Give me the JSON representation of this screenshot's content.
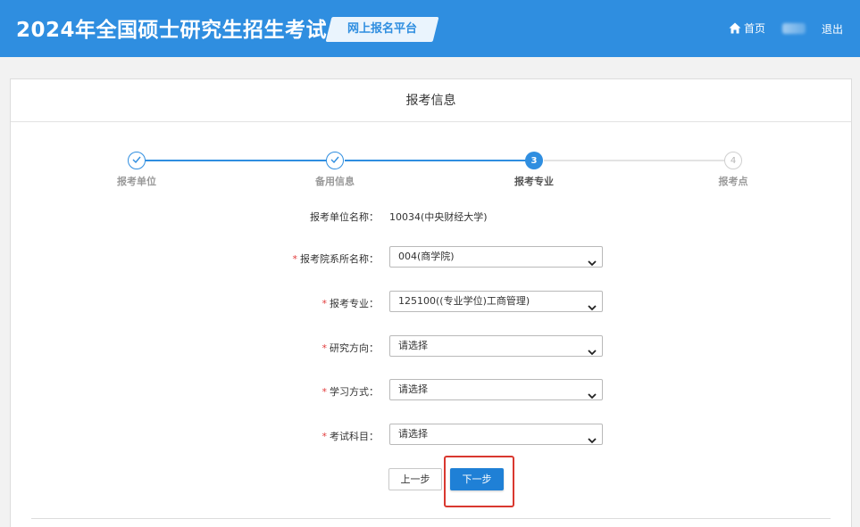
{
  "header": {
    "title": "2024年全国硕士研究生招生考试",
    "badge": "网上报名平台",
    "home_label": "首页",
    "logout_label": "退出"
  },
  "card": {
    "title": "报考信息"
  },
  "steps": [
    {
      "number": "1",
      "label": "报考单位",
      "state": "done"
    },
    {
      "number": "2",
      "label": "备用信息",
      "state": "done"
    },
    {
      "number": "3",
      "label": "报考专业",
      "state": "active"
    },
    {
      "number": "4",
      "label": "报考点",
      "state": "todo"
    }
  ],
  "form": {
    "unit": {
      "label": "报考单位名称：",
      "value": "10034(中央财经大学)"
    },
    "department": {
      "label": "报考院系所名称：",
      "value": "004(商学院)"
    },
    "major": {
      "label": "报考专业：",
      "value": "125100((专业学位)工商管理)"
    },
    "direction": {
      "label": "研究方向：",
      "value": "请选择"
    },
    "study_mode": {
      "label": "学习方式：",
      "value": "请选择"
    },
    "subjects": {
      "label": "考试科目：",
      "value": "请选择"
    }
  },
  "buttons": {
    "prev": "上一步",
    "next": "下一步"
  },
  "icons": {
    "home": "home-icon",
    "check": "check-icon",
    "chevron": "chevron-down-icon"
  },
  "colors": {
    "primary": "#2f8ee0",
    "button": "#1f80d6",
    "required": "#e23a3a",
    "highlight": "#d9382f"
  }
}
